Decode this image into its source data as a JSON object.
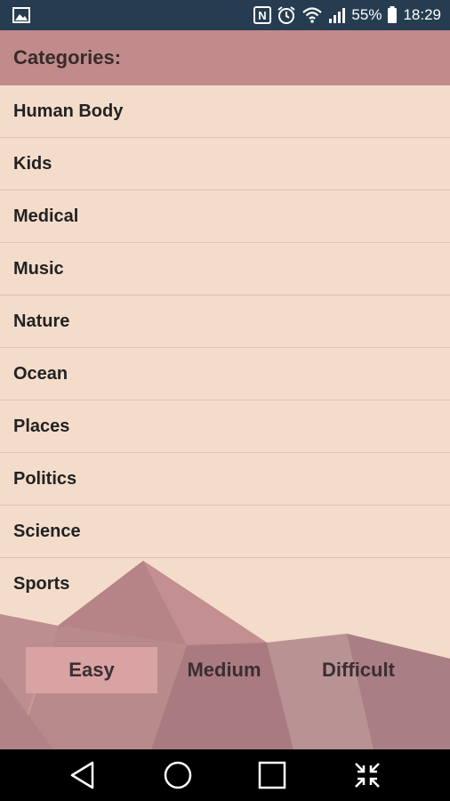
{
  "status_bar": {
    "left_icon": "image-icon",
    "icons": [
      "nfc-icon",
      "alarm-icon",
      "wifi-icon",
      "signal-icon"
    ],
    "battery_percent": "55%",
    "battery_icon": "battery-icon",
    "time": "18:29"
  },
  "header": {
    "title": "Categories:"
  },
  "categories": [
    {
      "label": "Human Body"
    },
    {
      "label": "Kids"
    },
    {
      "label": "Medical"
    },
    {
      "label": "Music"
    },
    {
      "label": "Nature"
    },
    {
      "label": "Ocean"
    },
    {
      "label": "Places"
    },
    {
      "label": "Politics"
    },
    {
      "label": "Science"
    },
    {
      "label": "Sports"
    }
  ],
  "difficulty": {
    "options": [
      {
        "label": "Easy",
        "selected": true
      },
      {
        "label": "Medium",
        "selected": false
      },
      {
        "label": "Difficult",
        "selected": false
      }
    ]
  },
  "nav_bar": {
    "buttons": [
      "back-icon",
      "home-icon",
      "recents-icon",
      "collapse-icon"
    ]
  },
  "colors": {
    "status_bar": "#263c50",
    "header": "#c18b8c",
    "list_background": "#f4dccb",
    "selected_difficulty": "#d9a2a3"
  }
}
